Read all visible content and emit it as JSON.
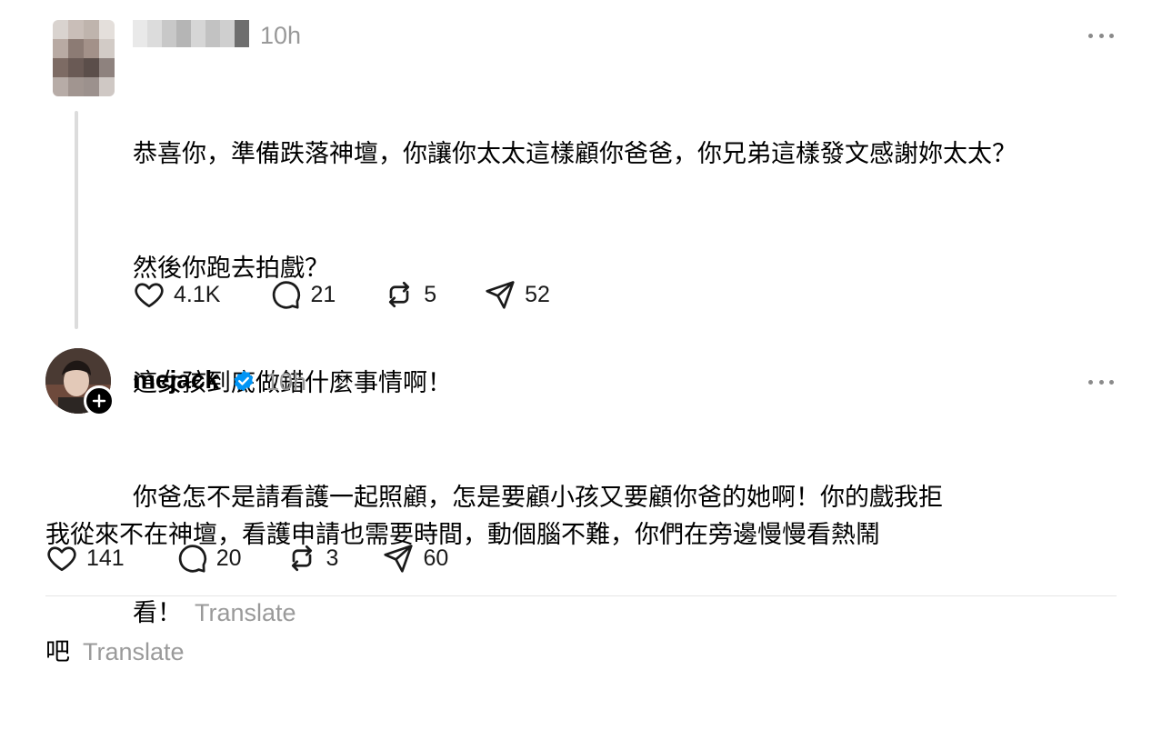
{
  "reply_post": {
    "timestamp": "10h",
    "lines": [
      "恭喜你，準備跌落神壇，你讓你太太這樣顧你爸爸，你兄弟這樣發文感謝妳太太？",
      "然後你跑去拍戲？",
      "這女孩到底做錯什麼事情啊！",
      "你爸怎不是請看護一起照顧，怎是要顧小孩又要顧你爸的她啊！你的戲我拒",
      "看！"
    ],
    "translate_label": "Translate",
    "likes": "4.1K",
    "comments": "21",
    "reposts": "5",
    "shares": "52",
    "icons": {
      "more": "more-horizontal-icon",
      "like": "heart-icon",
      "comment": "comment-icon",
      "repost": "repost-icon",
      "share": "send-icon"
    }
  },
  "author_post": {
    "username": "mejack",
    "verified": true,
    "timestamp": "10h",
    "lines": [
      "我從來不在神壇，看護申請也需要時間，動個腦不難，你們在旁邊慢慢看熱鬧",
      "吧"
    ],
    "translate_label": "Translate",
    "likes": "141",
    "comments": "20",
    "reposts": "3",
    "shares": "60",
    "icons": {
      "verified": "verified-badge-icon",
      "follow": "plus-icon",
      "more": "more-horizontal-icon"
    }
  },
  "colors": {
    "text": "#000000",
    "muted": "#999999",
    "verified": "#0095f6",
    "thread_line": "#dcdcdc"
  }
}
